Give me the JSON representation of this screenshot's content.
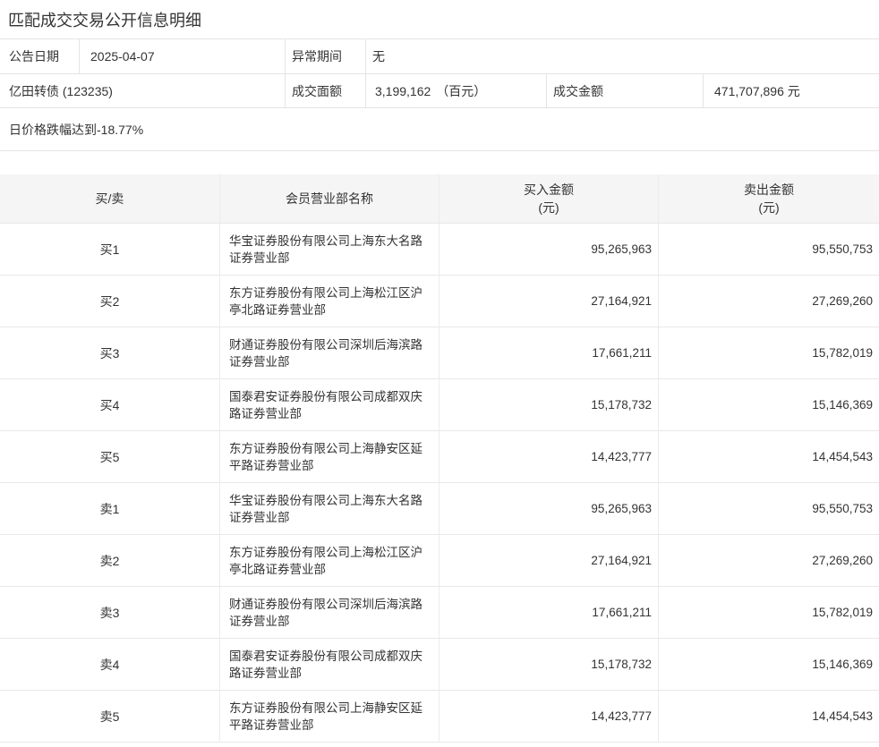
{
  "page": {
    "title": "匹配成交交易公开信息明细"
  },
  "info": {
    "announce_date_label": "公告日期",
    "announce_date": "2025-04-07",
    "abnormal_period_label": "异常期间",
    "abnormal_period": "无",
    "security_name": "亿田转债 (123235)",
    "face_value_label": "成交面额",
    "face_value": "3,199,162",
    "face_value_unit": "（百元）",
    "turnover_label": "成交金额",
    "turnover": "471,707,896 元",
    "note": "日价格跌幅达到-18.77%"
  },
  "table": {
    "headers": {
      "side": "买/卖",
      "member": "会员营业部名称",
      "buy_line1": "买入金额",
      "buy_line2": "(元)",
      "sell_line1": "卖出金额",
      "sell_line2": "(元)"
    },
    "rows": [
      {
        "side": "买1",
        "member": "华宝证券股份有限公司上海东大名路证券营业部",
        "buy": "95,265,963",
        "sell": "95,550,753"
      },
      {
        "side": "买2",
        "member": "东方证券股份有限公司上海松江区沪亭北路证券营业部",
        "buy": "27,164,921",
        "sell": "27,269,260"
      },
      {
        "side": "买3",
        "member": "财通证券股份有限公司深圳后海滨路证券营业部",
        "buy": "17,661,211",
        "sell": "15,782,019"
      },
      {
        "side": "买4",
        "member": "国泰君安证券股份有限公司成都双庆路证券营业部",
        "buy": "15,178,732",
        "sell": "15,146,369"
      },
      {
        "side": "买5",
        "member": "东方证券股份有限公司上海静安区延平路证券营业部",
        "buy": "14,423,777",
        "sell": "14,454,543"
      },
      {
        "side": "卖1",
        "member": "华宝证券股份有限公司上海东大名路证券营业部",
        "buy": "95,265,963",
        "sell": "95,550,753"
      },
      {
        "side": "卖2",
        "member": "东方证券股份有限公司上海松江区沪亭北路证券营业部",
        "buy": "27,164,921",
        "sell": "27,269,260"
      },
      {
        "side": "卖3",
        "member": "财通证券股份有限公司深圳后海滨路证券营业部",
        "buy": "17,661,211",
        "sell": "15,782,019"
      },
      {
        "side": "卖4",
        "member": "国泰君安证券股份有限公司成都双庆路证券营业部",
        "buy": "15,178,732",
        "sell": "15,146,369"
      },
      {
        "side": "卖5",
        "member": "东方证券股份有限公司上海静安区延平路证券营业部",
        "buy": "14,423,777",
        "sell": "14,454,543"
      }
    ]
  }
}
